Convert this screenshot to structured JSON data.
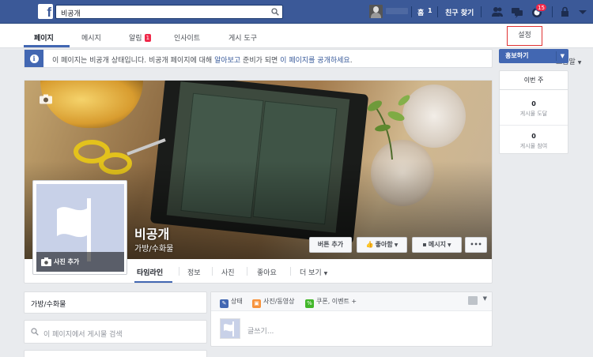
{
  "topbar": {
    "logo": "f",
    "search_value": "비공개",
    "home_label": "홈",
    "home_count": "1",
    "find_friends": "친구 찾기",
    "notification_count": "15"
  },
  "tabs": {
    "page": "페이지",
    "message": "메시지",
    "alarm": "알림",
    "alarm_count": "1",
    "insights": "인사이트",
    "publishing_tools": "게시 도구",
    "settings": "설정",
    "help": "도움말"
  },
  "notice": {
    "prefix": "이 페이지는 비공개 상태입니다. 비공개 페이지에 대해 ",
    "link1": "알아보고",
    "middle": " 준비가 되면 ",
    "link2": "이 페이지를 공개하세요",
    "suffix": "."
  },
  "sidebar": {
    "promote": "홍보하기",
    "week_title": "이번 주",
    "reach_value": "0",
    "reach_label": "게시물 도달",
    "engagement_value": "0",
    "engagement_label": "게시물 참여"
  },
  "cover": {
    "page_name": "비공개",
    "category": "가방/수화물",
    "add_photo": "사진 추가",
    "add_button": "버튼 추가",
    "like_button": "좋아함",
    "message_button": "메시지",
    "more_button": "•••"
  },
  "subtabs": {
    "timeline": "타임라인",
    "info": "정보",
    "photos": "사진",
    "likes": "좋아요",
    "more": "더 보기"
  },
  "left": {
    "category": "가방/수화물",
    "search_placeholder": "이 페이지에서 게시물 검색"
  },
  "composer": {
    "status": "상태",
    "photo_video": "사진/동영상",
    "coupon_event": "쿠폰, 이벤트 +",
    "placeholder": "글쓰기..."
  },
  "colors": {
    "brand": "#3b5998",
    "accent": "#4267b2",
    "badge": "#f02849"
  }
}
